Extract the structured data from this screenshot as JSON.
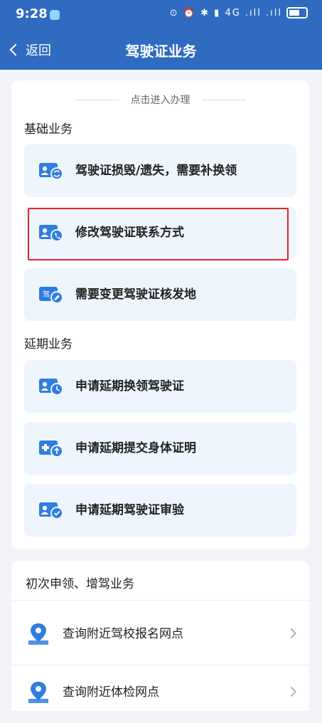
{
  "status_bar": {
    "time": "9:28",
    "icons_text": "⊙ ⏰ ✱ ▮ 4G .ıll .ıll"
  },
  "nav": {
    "back_label": "返回",
    "title": "驾驶证业务"
  },
  "hint": "点击进入办理",
  "sections": [
    {
      "title": "基础业务",
      "items": [
        {
          "label": "驾驶证损毁/遗失，需要补换领",
          "icon": "id-card-refresh-icon"
        },
        {
          "label": "修改驾驶证联系方式",
          "icon": "id-card-phone-icon",
          "highlighted": true
        },
        {
          "label": "需要变更驾驶证核发地",
          "icon": "license-edit-icon",
          "icon_text": "驾"
        }
      ]
    },
    {
      "title": "延期业务",
      "items": [
        {
          "label": "申请延期换领驾驶证",
          "icon": "id-card-clock-icon"
        },
        {
          "label": "申请延期提交身体证明",
          "icon": "medical-upload-icon"
        },
        {
          "label": "申请延期驾驶证审验",
          "icon": "id-card-check-icon"
        }
      ]
    }
  ],
  "second_card": {
    "title": "初次申领、增驾业务",
    "rows": [
      {
        "label": "查询附近驾校报名网点",
        "icon": "location-pin-icon"
      },
      {
        "label": "查询附近体检网点",
        "icon": "location-pin-icon"
      }
    ]
  },
  "colors": {
    "primary": "#2f6bc0",
    "item_bg": "#eef5fd",
    "icon_blue": "#2f7de1",
    "highlight": "#e0262a"
  }
}
